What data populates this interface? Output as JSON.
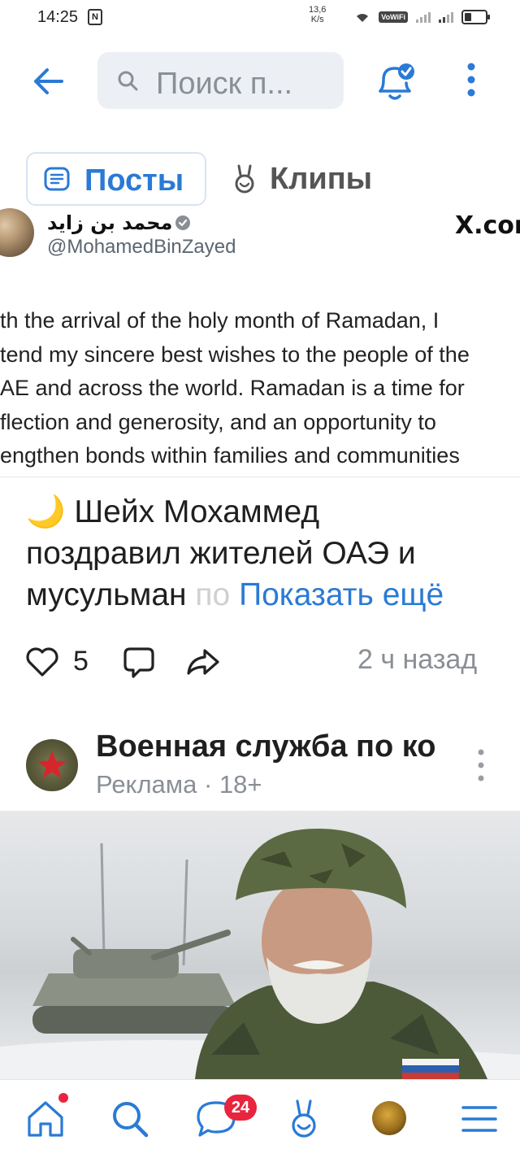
{
  "status_bar": {
    "time": "14:25",
    "net_speed_value": "13,6",
    "net_speed_unit": "K/s",
    "wifi_label": "VoWiFi"
  },
  "header": {
    "search_placeholder": "Поиск п..."
  },
  "tabs": [
    {
      "label": "Посты",
      "active": true
    },
    {
      "label": "Клипы",
      "active": false
    }
  ],
  "tweet_screenshot": {
    "author_name": "محمد بن زايد",
    "handle": "@MohamedBinZayed",
    "platform": "X.com",
    "lines": [
      "th the arrival of the holy month of Ramadan, I",
      "tend my sincere best wishes to the people of the",
      "AE and across the world. Ramadan is a time for",
      "flection and generosity, and an opportunity to",
      "engthen bonds within families and communities"
    ]
  },
  "post": {
    "emoji": "🌙",
    "line1": "Шейх Мохаммед",
    "line2": "поздравил жителей ОАЭ и",
    "line3": "мусульман",
    "line3_fade": "по",
    "show_more": "Показать ещё",
    "likes": "5",
    "time_ago": "2 ч назад"
  },
  "ad": {
    "title": "Военная служба по ко",
    "subtitle": "Реклама · 18+"
  },
  "bottom_nav": {
    "messages_badge": "24"
  },
  "colors": {
    "accent": "#2a7ad6",
    "badge": "#e8243f",
    "muted": "#8a8f96"
  }
}
